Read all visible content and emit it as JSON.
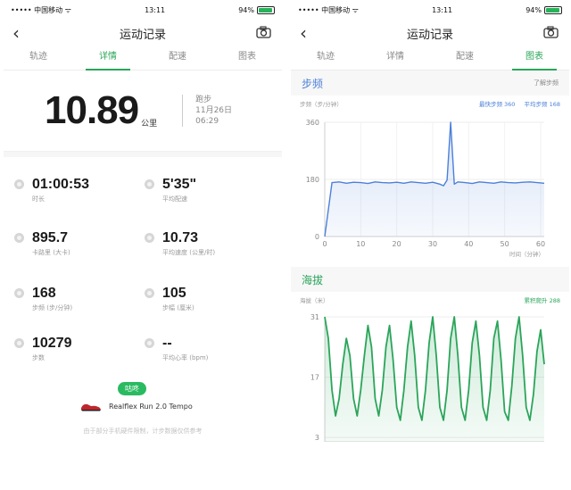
{
  "left": {
    "status": {
      "carrier": "••••• 中国移动 ᯤ",
      "time": "13:11",
      "battery": "94%"
    },
    "nav": {
      "title": "运动记录"
    },
    "tabs": [
      {
        "label": "轨迹"
      },
      {
        "label": "详情"
      },
      {
        "label": "配速"
      },
      {
        "label": "图表"
      }
    ],
    "distance": {
      "value": "10.89",
      "unit": "公里",
      "type": "跑步",
      "date": "11月26日",
      "time": "06:29"
    },
    "stats": [
      {
        "value": "01:00:53",
        "label": "时长"
      },
      {
        "value": "5'35\"",
        "label": "平均配速"
      },
      {
        "value": "895.7",
        "label": "卡路里 (大卡)"
      },
      {
        "value": "10.73",
        "label": "平均速度 (公里/时)"
      },
      {
        "value": "168",
        "label": "步频 (步/分钟)"
      },
      {
        "value": "105",
        "label": "步幅 (厘米)"
      },
      {
        "value": "10279",
        "label": "步数"
      },
      {
        "value": "--",
        "label": "平均心率 (bpm)"
      }
    ],
    "badge": "咕咚",
    "shoe": "Realflex Run 2.0 Tempo",
    "note": "由于部分手机硬件限制，计步数据仅供参考"
  },
  "right": {
    "status": {
      "carrier": "••••• 中国移动 ᯤ",
      "time": "13:11",
      "battery": "94%"
    },
    "nav": {
      "title": "运动记录"
    },
    "tabs": [
      {
        "label": "轨迹"
      },
      {
        "label": "详情"
      },
      {
        "label": "配速"
      },
      {
        "label": "图表"
      }
    ],
    "cadence": {
      "title": "步频",
      "link": "了解步频",
      "unit_label": "步频（步/分钟）",
      "max_label": "最快步频 360",
      "avg_label": "平均步频 168",
      "xlabel": "时间（分钟）"
    },
    "altitude": {
      "title": "海拔",
      "unit_label": "海拔（米）",
      "gain_label": "累积爬升 288"
    }
  },
  "colors": {
    "green": "#2aa55a",
    "blue": "#4c80d9"
  },
  "chart_data": [
    {
      "type": "area",
      "title": "步频",
      "ylabel": "步频（步/分钟）",
      "xlabel": "时间（分钟）",
      "ylim": [
        0,
        360
      ],
      "xlim": [
        0,
        61
      ],
      "yticks": [
        0,
        180,
        360
      ],
      "xticks": [
        0,
        10,
        20,
        30,
        40,
        50,
        60
      ],
      "grid": true,
      "color": "#4c80d9",
      "series": [
        {
          "x": [
            0,
            2,
            4,
            6,
            8,
            10,
            12,
            14,
            16,
            18,
            20,
            22,
            24,
            26,
            28,
            30,
            32,
            33,
            34,
            35,
            36,
            37,
            39,
            41,
            43,
            45,
            47,
            49,
            51,
            53,
            55,
            57,
            59,
            61
          ],
          "values": [
            0,
            170,
            172,
            168,
            171,
            170,
            167,
            172,
            170,
            169,
            171,
            168,
            172,
            170,
            168,
            171,
            165,
            160,
            178,
            360,
            165,
            172,
            170,
            167,
            172,
            170,
            168,
            172,
            170,
            169,
            171,
            172,
            170,
            168
          ]
        }
      ]
    },
    {
      "type": "area",
      "title": "海拔",
      "ylabel": "海拔（米）",
      "ylim": [
        2,
        31
      ],
      "xlim": [
        0,
        61
      ],
      "yticks": [
        3,
        17,
        31
      ],
      "grid": true,
      "color": "#2aa55a",
      "series": [
        {
          "x": [
            0,
            1,
            2,
            3,
            4,
            5,
            6,
            7,
            8,
            9,
            10,
            11,
            12,
            13,
            14,
            15,
            16,
            17,
            18,
            19,
            20,
            21,
            22,
            23,
            24,
            25,
            26,
            27,
            28,
            29,
            30,
            31,
            32,
            33,
            34,
            35,
            36,
            37,
            38,
            39,
            40,
            41,
            42,
            43,
            44,
            45,
            46,
            47,
            48,
            49,
            50,
            51,
            52,
            53,
            54,
            55,
            56,
            57,
            58,
            59,
            60,
            61
          ],
          "values": [
            31,
            26,
            14,
            8,
            12,
            20,
            26,
            22,
            12,
            8,
            14,
            22,
            29,
            24,
            12,
            8,
            14,
            24,
            29,
            21,
            10,
            7,
            14,
            24,
            30,
            22,
            10,
            7,
            14,
            25,
            31,
            22,
            10,
            7,
            14,
            26,
            31,
            22,
            10,
            7,
            14,
            25,
            30,
            22,
            10,
            7,
            14,
            26,
            30,
            21,
            9,
            7,
            15,
            26,
            31,
            22,
            10,
            7,
            13,
            23,
            28,
            20
          ]
        }
      ]
    }
  ]
}
